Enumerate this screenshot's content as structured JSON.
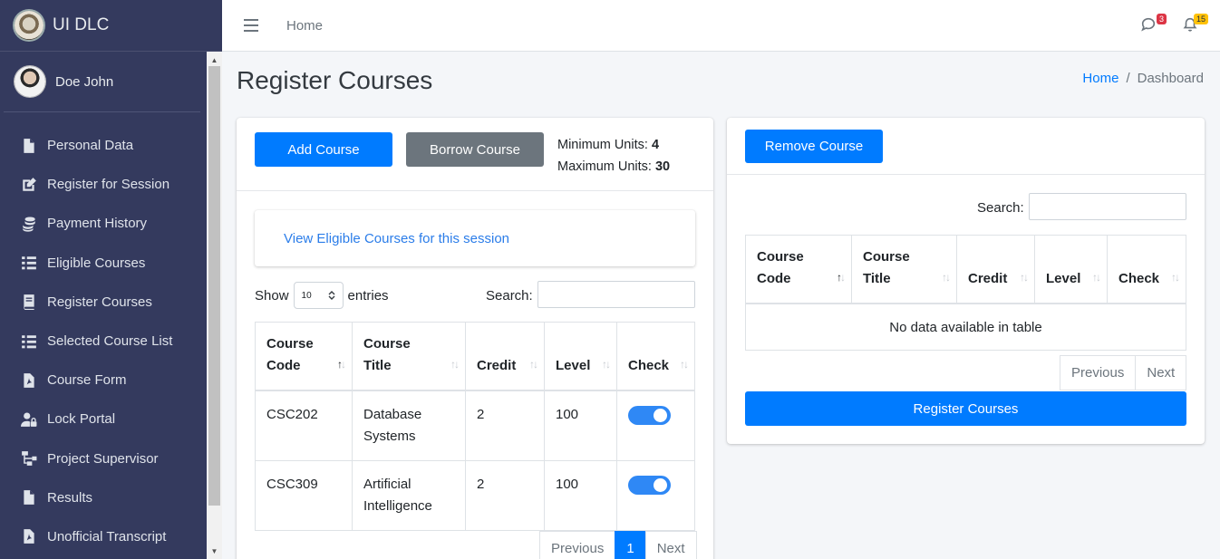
{
  "brand": {
    "name": "UI DLC"
  },
  "user": {
    "name": "Doe John"
  },
  "sidebar": {
    "items": [
      {
        "label": "Personal Data",
        "icon": "file-icon"
      },
      {
        "label": "Register for Session",
        "icon": "edit-icon"
      },
      {
        "label": "Payment History",
        "icon": "coins-icon"
      },
      {
        "label": "Eligible Courses",
        "icon": "list-icon"
      },
      {
        "label": "Register Courses",
        "icon": "book-icon"
      },
      {
        "label": "Selected Course List",
        "icon": "list-icon"
      },
      {
        "label": "Course Form",
        "icon": "pdf-icon"
      },
      {
        "label": "Lock Portal",
        "icon": "user-lock-icon"
      },
      {
        "label": "Project Supervisor",
        "icon": "sitemap-icon"
      },
      {
        "label": "Results",
        "icon": "file-icon"
      },
      {
        "label": "Unofficial Transcript",
        "icon": "pdf-icon"
      }
    ]
  },
  "header": {
    "home_link": "Home",
    "messages_count": "3",
    "notifications_count": "15"
  },
  "page": {
    "title": "Register Courses",
    "breadcrumb": {
      "home": "Home",
      "current": "Dashboard"
    }
  },
  "left_card": {
    "add_course": "Add Course",
    "borrow_course": "Borrow Course",
    "min_units_label": "Minimum Units:",
    "min_units_value": "4",
    "max_units_label": "Maximum Units:",
    "max_units_value": "30",
    "eligible_link": "View Eligible Courses for this session",
    "show_label": "Show",
    "entries_value": "10",
    "entries_label": "entries",
    "search_label": "Search:",
    "columns": {
      "code": "Course Code",
      "title": "Course Title",
      "credit": "Credit",
      "level": "Level",
      "check": "Check"
    },
    "rows": [
      {
        "code": "CSC202",
        "title": "Database Systems",
        "credit": "2",
        "level": "100",
        "checked": true
      },
      {
        "code": "CSC309",
        "title": "Artificial Intelligence",
        "credit": "2",
        "level": "100",
        "checked": true
      }
    ],
    "pager": {
      "previous": "Previous",
      "page": "1",
      "next": "Next"
    }
  },
  "right_card": {
    "remove_course": "Remove Course",
    "search_label": "Search:",
    "columns": {
      "code": "Course Code",
      "title": "Course Title",
      "credit": "Credit",
      "level": "Level",
      "check": "Check"
    },
    "empty": "No data available in table",
    "pager": {
      "previous": "Previous",
      "next": "Next"
    },
    "register": "Register Courses"
  }
}
